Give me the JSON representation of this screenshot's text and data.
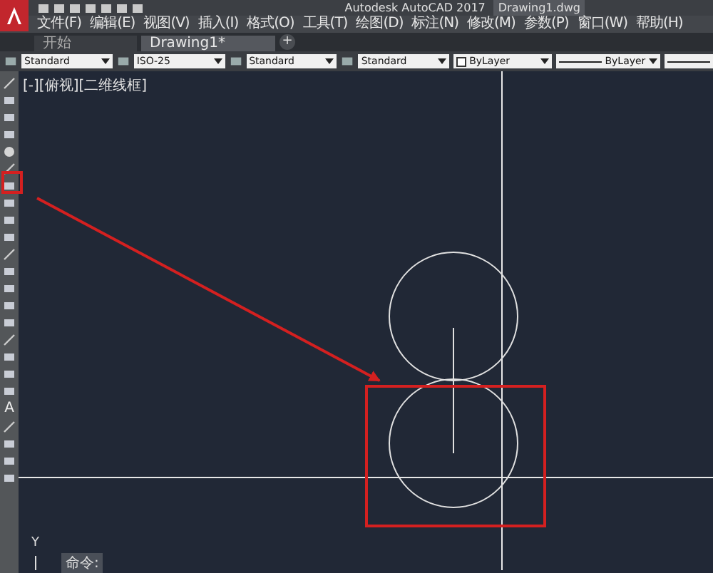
{
  "window": {
    "app_title": "Autodesk AutoCAD 2017",
    "file_title": "Drawing1.dwg"
  },
  "menu": [
    "文件(F)",
    "编辑(E)",
    "视图(V)",
    "插入(I)",
    "格式(O)",
    "工具(T)",
    "绘图(D)",
    "标注(N)",
    "修改(M)",
    "参数(P)",
    "窗口(W)",
    "帮助(H)"
  ],
  "tabs": [
    {
      "label": "开始",
      "selected": false
    },
    {
      "label": "Drawing1*",
      "selected": true
    }
  ],
  "tab_add": "+",
  "properties": [
    {
      "kind": "dropdown",
      "value": "Standard"
    },
    {
      "kind": "dropdown",
      "value": "ISO-25"
    },
    {
      "kind": "dropdown",
      "value": "Standard"
    },
    {
      "kind": "dropdown",
      "value": "Standard"
    },
    {
      "kind": "color",
      "value": "ByLayer"
    },
    {
      "kind": "linetype",
      "value": "ByLayer"
    }
  ],
  "viewport_label": "[-][俯视][二维线框]",
  "text_tool": "A",
  "ucs_label": "Y",
  "command_prompt": "命令:"
}
